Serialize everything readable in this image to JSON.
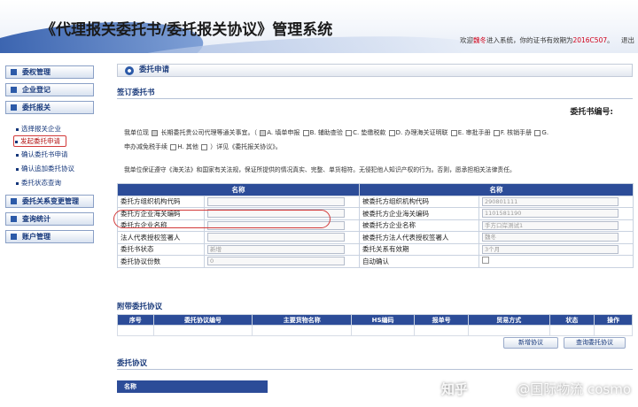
{
  "header": {
    "app_title": "《代理报关委托书/委托报关协议》管理系统",
    "welcome_prefix": "欢迎",
    "user": "魏冬",
    "welcome_mid": "进入系统，你的证书有效期为",
    "cert_expiry": "2016C507",
    "logout_label": "退出"
  },
  "sidebar": {
    "sections": [
      {
        "label": "委权管理"
      },
      {
        "label": "企业登记"
      },
      {
        "label": "委托报关"
      }
    ],
    "sub_items": [
      {
        "label": "选择报关企业"
      },
      {
        "label": "发起委托申请"
      },
      {
        "label": "确认委托书申请"
      },
      {
        "label": "确认追加委托协议"
      },
      {
        "label": "委托状态查询"
      }
    ],
    "sections_bottom": [
      {
        "label": "委托关系变更管理"
      },
      {
        "label": "查询统计"
      },
      {
        "label": "账户管理"
      }
    ]
  },
  "panel": {
    "title": "委托申请",
    "section_sign": "签订委托书",
    "doc_no_label": "委托书编号:",
    "para1_a": "我单位现",
    "para1_b": "长期委托贵公司代理等通关事宜。（",
    "opt_a": "A. 填单申报",
    "opt_b": "B. 辅助查验",
    "opt_c": "C. 垫缴税款",
    "opt_d": "D. 办理海关证明联",
    "opt_e": "E. 审批手册",
    "opt_f": "F. 核销手册",
    "opt_g": "G.",
    "para2_a": "申办减免税手续",
    "opt_h": "H. 其他",
    "para2_b": "）详见《委托报关协议》。",
    "para3": "我单位保证遵守《海关法》和国家有关法规，保证所提供的情况真实、完整、单货相符。无侵犯他人知识产权的行为。否则，愿承担相关法律责任。"
  },
  "form": {
    "col_header_left": "名称",
    "col_header_right": "名称",
    "rows": [
      {
        "left_label": "委托方组织机构代码",
        "left_value": "",
        "right_label": "被委托方组织机构代码",
        "right_value": "290801111"
      },
      {
        "left_label": "委托方企业海关编码",
        "left_value": "",
        "right_label": "被委托方企业海关编码",
        "right_value": "1101581190"
      },
      {
        "left_label": "委托方企业名称",
        "left_value": "",
        "right_label": "被委托方企业名称",
        "right_value": "手方口岸测试1"
      },
      {
        "left_label": "法人代表授权签署人",
        "left_value": "",
        "right_label": "被委托方法人代表授权签署人",
        "right_value": "魏冬"
      },
      {
        "left_label": "委托书状态",
        "left_value": "新增",
        "right_label": "委托关系有效期",
        "right_value": "3个月"
      },
      {
        "left_label": "委托协议份数",
        "left_value": "0",
        "right_label": "自动确认",
        "right_value": ""
      }
    ]
  },
  "attachments": {
    "title": "附带委托协议",
    "columns": [
      "序号",
      "委托协议编号",
      "主要货物名称",
      "HS编码",
      "报单号",
      "贸易方式",
      "状态",
      "操作"
    ],
    "btn_add": "新增协议",
    "btn_query": "查询委托协议"
  },
  "bottom": {
    "title": "委托协议",
    "table_header": "名称"
  },
  "watermark": {
    "logo": "知乎",
    "text": "@国际物流 cosmo"
  }
}
